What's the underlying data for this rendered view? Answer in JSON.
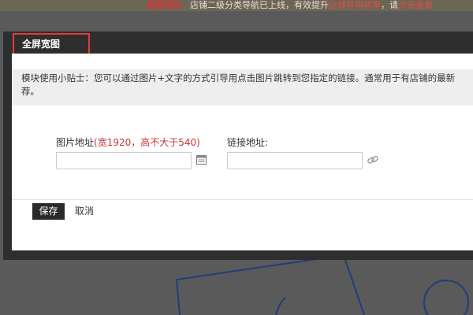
{
  "background": {
    "notice_strong": "重要通知：",
    "notice_text": "店铺二级分类导航已上线，有效提升",
    "notice_highlight": "店铺导购效率",
    "notice_tail": "，请",
    "notice_link": "点击查看"
  },
  "modal": {
    "title": "全屏宽图",
    "tip_line1": "模块使用小贴士：您可以通过图片+文字的方式引导用点击图片跳转到您指定的链接。通常用于有店铺的最新",
    "tip_line2": "荐。",
    "image_field": {
      "label": "图片地址",
      "note": "(宽1920，高不大于540)",
      "value": "",
      "placeholder": ""
    },
    "link_field": {
      "label": "链接地址:",
      "value": "",
      "placeholder": ""
    },
    "save_label": "保存",
    "cancel_label": "取消"
  },
  "icons": {
    "image_picker": "image-picker-icon",
    "link": "chain-link-icon"
  },
  "colors": {
    "title_highlight_border": "#e23b3b",
    "note_red": "#cc3333",
    "save_button_bg": "#2a2a2a",
    "overlay": "#5a5a5a",
    "shape_stroke": "#1e3f78"
  }
}
